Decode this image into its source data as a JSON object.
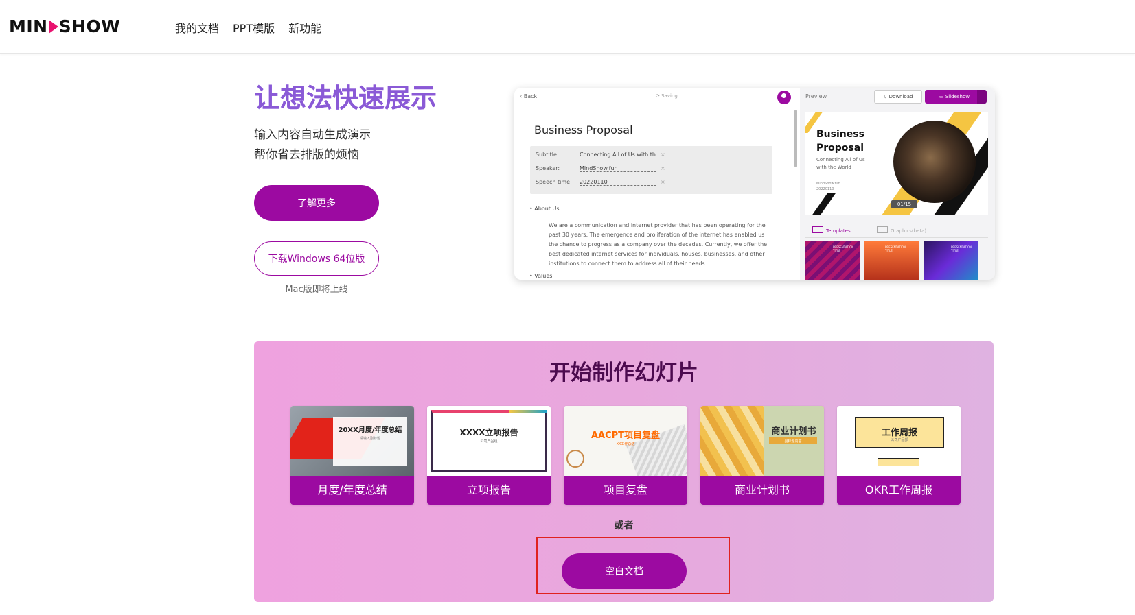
{
  "header": {
    "logo": "MIN SHOW",
    "logo_left": "MIN",
    "logo_right": "SHOW",
    "nav": [
      "我的文档",
      "PPT模版",
      "新功能"
    ]
  },
  "hero": {
    "title": "让想法快速展示",
    "subtitle_line1": "输入内容自动生成演示",
    "subtitle_line2": "帮你省去排版的烦恼",
    "learn_more": "了解更多",
    "download_windows": "下载Windows 64位版",
    "mac_note": "Mac版即将上线"
  },
  "app_preview": {
    "back": "Back",
    "saving": "Saving...",
    "doc_title": "Business Proposal",
    "meta": [
      {
        "label": "Subtitle:",
        "value": "Connecting All of Us with th"
      },
      {
        "label": "Speaker:",
        "value": "MindShow.fun"
      },
      {
        "label": "Speech time:",
        "value": "20220110"
      }
    ],
    "about": "About Us",
    "paragraph": "We are a communication and internet provider that has been operating for the past 30 years. The emergence and proliferation of the internet has enabled us the chance to progress as a company over the decades. Currently, we offer the best dedicated internet services for individuals, houses, businesses, and other institutions to connect them to address all of their needs.",
    "values": "Values",
    "preview_label": "Preview",
    "download": "Download",
    "slideshow": "Slideshow",
    "slide_title_1": "Business",
    "slide_title_2": "Proposal",
    "slide_sub": "Connecting All of Us with the World",
    "slide_small_1": "MindShow.fun",
    "slide_small_2": "20220110",
    "page_indicator": "01/15",
    "tab_templates": "Templates",
    "tab_graphics": "Graphics(beta)",
    "thumb_text": "PRESENTATION TITLE",
    "accent": "#9c0aa1"
  },
  "start": {
    "title": "开始制作幻灯片",
    "cards": [
      {
        "label": "月度/年度总结",
        "thumb_title": "20XX月度/年度总结",
        "thumb_sub": "请输入副标题"
      },
      {
        "label": "立项报告",
        "thumb_title": "XXXX立项报告",
        "thumb_sub": "公司产品组"
      },
      {
        "label": "项目复盘",
        "thumb_title": "AACPT项目复盘",
        "thumb_sub": "XX工作总结"
      },
      {
        "label": "商业计划书",
        "thumb_title": "商业计划书",
        "thumb_sub": "副标题内容"
      },
      {
        "label": "OKR工作周报",
        "thumb_title": "工作周报",
        "thumb_sub": "公司产品部"
      }
    ],
    "or": "或者",
    "blank_doc": "空白文档"
  }
}
